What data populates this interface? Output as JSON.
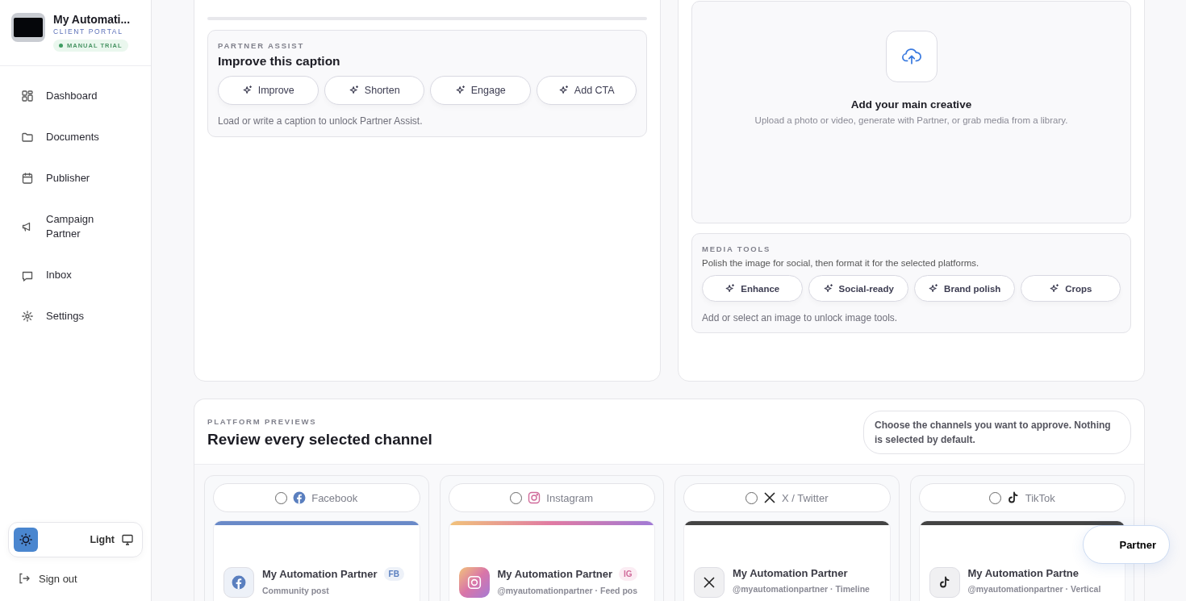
{
  "brand": {
    "name": "My Automati...",
    "subtitle": "CLIENT PORTAL",
    "badge": "MANUAL TRIAL"
  },
  "nav": [
    {
      "label": "Dashboard",
      "selected": false
    },
    {
      "label": "Documents",
      "selected": false
    },
    {
      "label": "Publisher",
      "selected": false
    },
    {
      "label": "Campaign Partner",
      "selected": false
    },
    {
      "label": "Inbox",
      "selected": false
    },
    {
      "label": "Settings",
      "selected": false
    }
  ],
  "theme": {
    "label": "Light"
  },
  "sign_out": "Sign out",
  "partner_assist": {
    "eyebrow": "PARTNER ASSIST",
    "title": "Improve this caption",
    "actions": [
      "Improve",
      "Shorten",
      "Engage",
      "Add CTA"
    ],
    "hint": "Load or write a caption to unlock Partner Assist."
  },
  "upload": {
    "title": "Add your main creative",
    "subtitle": "Upload a photo or video, generate with Partner, or grab media from a library."
  },
  "media_tools": {
    "eyebrow": "MEDIA TOOLS",
    "description": "Polish the image for social, then format it for the selected platforms.",
    "actions": [
      "Enhance",
      "Social-ready",
      "Brand polish",
      "Crops"
    ],
    "hint": "Add or select an image to unlock image tools."
  },
  "previews": {
    "eyebrow": "PLATFORM PREVIEWS",
    "title": "Review every selected channel",
    "note": "Choose the channels you want to approve. Nothing is selected by default.",
    "channels": [
      {
        "kind": "facebook",
        "label": "Facebook",
        "selected": false,
        "account": "My Automation Partner",
        "badge": "FB",
        "subtitle": "Community post"
      },
      {
        "kind": "instagram",
        "label": "Instagram",
        "selected": false,
        "account": "My Automation Partner",
        "badge": "IG",
        "subtitle": "@myautomationpartner · Feed pos"
      },
      {
        "kind": "x",
        "label": "X / Twitter",
        "selected": false,
        "account": "My Automation Partner",
        "subtitle": "@myautomationpartner · Timeline"
      },
      {
        "kind": "tiktok",
        "label": "TikTok",
        "selected": false,
        "account": "My Automation Partne",
        "subtitle": "@myautomationpartner · Vertical"
      }
    ]
  },
  "partner_button": "Partner"
}
